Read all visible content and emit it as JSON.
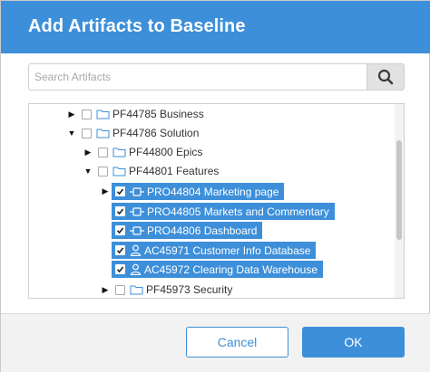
{
  "dialog": {
    "title": "Add Artifacts to Baseline",
    "search": {
      "placeholder": "Search Artifacts",
      "value": ""
    },
    "cancel_label": "Cancel",
    "ok_label": "OK"
  },
  "tree": {
    "items": [
      {
        "label": "PF44785 Business",
        "expanded": false,
        "checked": false,
        "type": "folder"
      },
      {
        "label": "PF44786 Solution",
        "expanded": true,
        "checked": false,
        "type": "folder"
      },
      {
        "label": "PF44800 Epics",
        "expanded": false,
        "checked": false,
        "type": "folder"
      },
      {
        "label": "PF44801 Features",
        "expanded": true,
        "checked": false,
        "type": "folder"
      },
      {
        "label": "PRO44804 Marketing page",
        "expanded": false,
        "checked": true,
        "type": "feature"
      },
      {
        "label": "PRO44805 Markets and Commentary",
        "checked": true,
        "type": "feature"
      },
      {
        "label": "PRO44806 Dashboard",
        "checked": true,
        "type": "feature"
      },
      {
        "label": "AC45971 Customer Info Database",
        "checked": true,
        "type": "user"
      },
      {
        "label": "AC45972 Clearing Data Warehouse",
        "checked": true,
        "type": "user"
      },
      {
        "label": "PF45973 Security",
        "expanded": false,
        "checked": false,
        "type": "folder"
      }
    ]
  },
  "colors": {
    "accent": "#3d8fd9",
    "footer_bg": "#f2f2f2"
  },
  "icons": {
    "search": "magnifier-icon",
    "folder": "folder-icon",
    "feature": "feature-icon",
    "user": "user-icon"
  }
}
